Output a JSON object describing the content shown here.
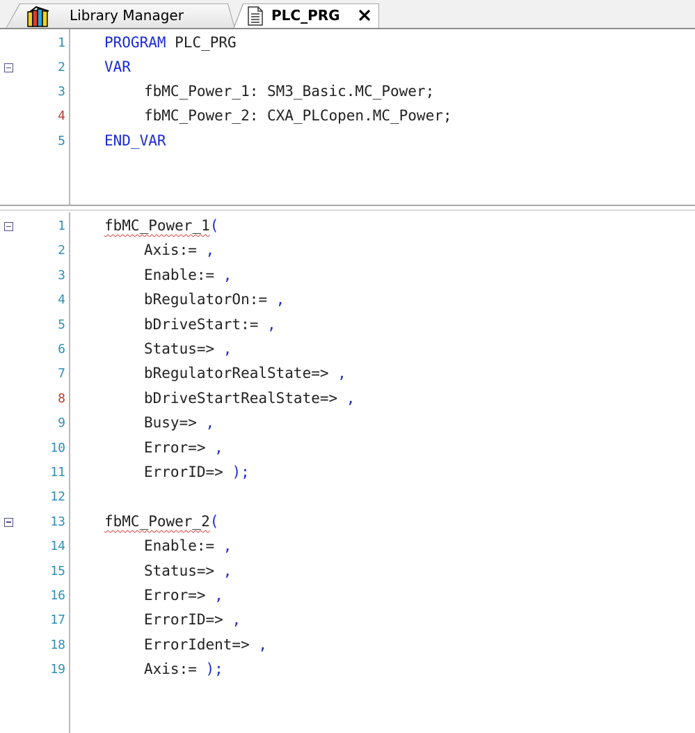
{
  "tabs": [
    {
      "label": "Library Manager",
      "active": false,
      "icon": "library-icon"
    },
    {
      "label": "PLC_PRG",
      "active": true,
      "icon": "document-icon",
      "close_glyph": "✕"
    }
  ],
  "declaration": {
    "lines": [
      {
        "num": "1",
        "fold": false,
        "modified": false
      },
      {
        "num": "2",
        "fold": true,
        "modified": false
      },
      {
        "num": "3",
        "fold": false,
        "modified": false
      },
      {
        "num": "4",
        "fold": false,
        "modified": true
      },
      {
        "num": "5",
        "fold": false,
        "modified": false
      }
    ],
    "code": {
      "l1_kw": "PROGRAM",
      "l1_name": " PLC_PRG",
      "l2_kw": "VAR",
      "l3_name": "fbMC_Power_1: SM3_Basic.MC_Power;",
      "l4_name": "fbMC_Power_2: CXA_PLCopen.MC_Power;",
      "l5_kw": "END_VAR"
    }
  },
  "implementation": {
    "lines": [
      {
        "num": "1",
        "fold": true,
        "modified": false,
        "indent": 0,
        "text": "fbMC_Power_1",
        "tail": "(",
        "squiggle": true
      },
      {
        "num": "2",
        "fold": false,
        "modified": false,
        "indent": 1,
        "text": "Axis:=",
        "tail": " ,"
      },
      {
        "num": "3",
        "fold": false,
        "modified": false,
        "indent": 1,
        "text": "Enable:=",
        "tail": " ,"
      },
      {
        "num": "4",
        "fold": false,
        "modified": false,
        "indent": 1,
        "text": "bRegulatorOn:=",
        "tail": " ,"
      },
      {
        "num": "5",
        "fold": false,
        "modified": false,
        "indent": 1,
        "text": "bDriveStart:=",
        "tail": " ,"
      },
      {
        "num": "6",
        "fold": false,
        "modified": false,
        "indent": 1,
        "text": "Status=>",
        "tail": " ,"
      },
      {
        "num": "7",
        "fold": false,
        "modified": false,
        "indent": 1,
        "text": "bRegulatorRealState=>",
        "tail": " ,"
      },
      {
        "num": "8",
        "fold": false,
        "modified": true,
        "indent": 1,
        "text": "bDriveStartRealState=>",
        "tail": " ,"
      },
      {
        "num": "9",
        "fold": false,
        "modified": false,
        "indent": 1,
        "text": "Busy=>",
        "tail": " ,"
      },
      {
        "num": "10",
        "fold": false,
        "modified": false,
        "indent": 1,
        "text": "Error=>",
        "tail": " ,"
      },
      {
        "num": "11",
        "fold": false,
        "modified": false,
        "indent": 1,
        "text": "ErrorID=>",
        "tail": " );"
      },
      {
        "num": "12",
        "fold": false,
        "modified": false,
        "indent": 0,
        "text": "",
        "tail": ""
      },
      {
        "num": "13",
        "fold": true,
        "modified": false,
        "indent": 0,
        "text": "fbMC_Power_2",
        "tail": "(",
        "squiggle": true
      },
      {
        "num": "14",
        "fold": false,
        "modified": false,
        "indent": 1,
        "text": "Enable:=",
        "tail": " ,"
      },
      {
        "num": "15",
        "fold": false,
        "modified": false,
        "indent": 1,
        "text": "Status=>",
        "tail": " ,"
      },
      {
        "num": "16",
        "fold": false,
        "modified": false,
        "indent": 1,
        "text": "Error=>",
        "tail": " ,"
      },
      {
        "num": "17",
        "fold": false,
        "modified": false,
        "indent": 1,
        "text": "ErrorID=>",
        "tail": " ,"
      },
      {
        "num": "18",
        "fold": false,
        "modified": false,
        "indent": 1,
        "text": "ErrorIdent=>",
        "tail": " ,"
      },
      {
        "num": "19",
        "fold": false,
        "modified": false,
        "indent": 1,
        "text": "Axis:=",
        "tail": " );"
      }
    ]
  },
  "colors": {
    "keyword": "#1a2bd6",
    "line_number": "#2b8fb8",
    "line_number_modified": "#c0392b",
    "error_squiggle": "#e04040"
  }
}
